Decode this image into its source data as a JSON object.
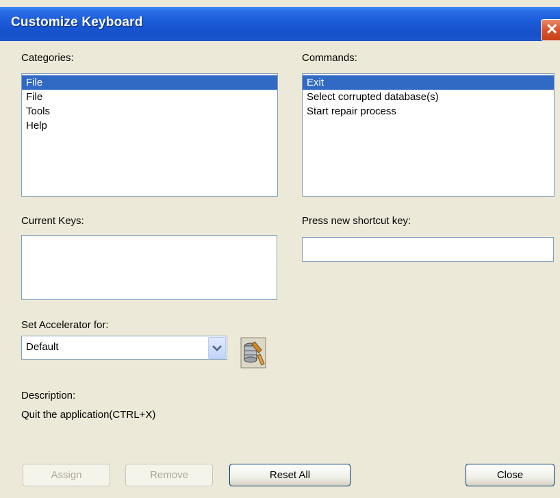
{
  "window": {
    "title": "Customize Keyboard",
    "close_glyph": "✕"
  },
  "categories": {
    "label": "Categories:",
    "items": [
      "File",
      "File",
      "Tools",
      "Help"
    ],
    "selected_index": 0
  },
  "commands": {
    "label": "Commands:",
    "items": [
      "Exit",
      "Select corrupted database(s)",
      "Start repair process"
    ],
    "selected_index": 0
  },
  "current_keys": {
    "label": "Current Keys:"
  },
  "new_shortcut": {
    "label": "Press new shortcut key:",
    "value": ""
  },
  "accelerator": {
    "label": "Set Accelerator for:",
    "selected": "Default"
  },
  "description": {
    "label": "Description:",
    "text": "Quit the application(CTRL+X)"
  },
  "buttons": {
    "assign": "Assign",
    "remove": "Remove",
    "reset_all": "Reset All",
    "close": "Close"
  },
  "colors": {
    "selection": "#316ac5",
    "titlebar": "#1b5ad8",
    "face": "#ece9d8"
  }
}
